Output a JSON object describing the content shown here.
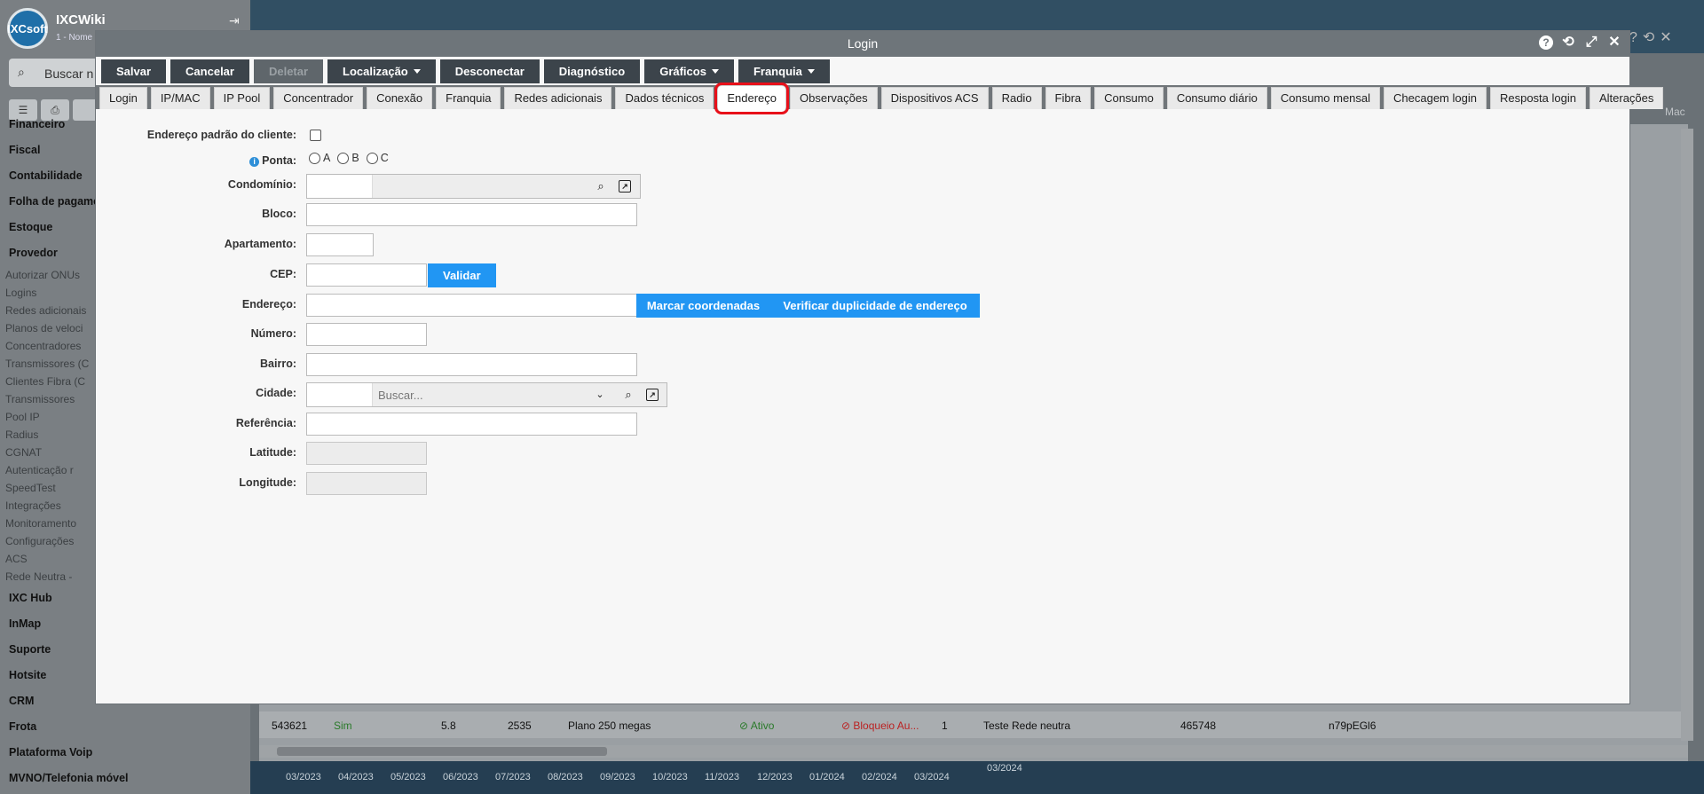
{
  "background": {
    "app_name": "IXCWiki",
    "app_sub": "1 - Nome",
    "logo_text": "IXCsoft",
    "search_placeholder": "Buscar n",
    "menu_top": [
      "Financeiro",
      "Fiscal",
      "Contabilidade",
      "Folha de pagame",
      "Estoque",
      "Provedor"
    ],
    "menu_sub": [
      "Autorizar ONUs",
      "Logins",
      "Redes adicionais",
      "Planos de veloci",
      "Concentradores",
      "Transmissores (C",
      "Clientes Fibra (C",
      "Transmissores",
      "Pool IP",
      "Radius",
      "CGNAT",
      "Autenticação r",
      "SpeedTest",
      "Integrações",
      "Monitoramento",
      "Configurações",
      "ACS",
      "Rede Neutra - "
    ],
    "menu_bottom": [
      "IXC Hub",
      "InMap",
      "Suporte",
      "Hotsite",
      "CRM",
      "Frota",
      "Plataforma Voip",
      "MVNO/Telefonia móvel"
    ],
    "row": {
      "id": "543621",
      "flag": "Sim",
      "v1": "5.8",
      "v2": "2535",
      "plan": "Plano 250 megas",
      "status": "Ativo",
      "block": "Bloqueio Au...",
      "n": "1",
      "desc": "Teste Rede neutra",
      "code": "465748",
      "hash": "n79pEGl6"
    },
    "mac_label": "Mac",
    "dates": [
      "03/2023",
      "04/2023",
      "05/2023",
      "06/2023",
      "07/2023",
      "08/2023",
      "09/2023",
      "10/2023",
      "11/2023",
      "12/2023",
      "01/2024",
      "02/2024",
      "03/2024",
      "03/2024"
    ]
  },
  "modal": {
    "title": "Login",
    "toolbar": {
      "save": "Salvar",
      "cancel": "Cancelar",
      "delete": "Deletar",
      "location": "Localização",
      "disconnect": "Desconectar",
      "diagnostic": "Diagnóstico",
      "charts": "Gráficos",
      "franchise": "Franquia"
    },
    "tabs": [
      "Login",
      "IP/MAC",
      "IP Pool",
      "Concentrador",
      "Conexão",
      "Franquia",
      "Redes adicionais",
      "Dados técnicos",
      "Endereço",
      "Observações",
      "Dispositivos ACS",
      "Radio",
      "Fibra",
      "Consumo",
      "Consumo diário",
      "Consumo mensal",
      "Checagem login",
      "Resposta login",
      "Alterações"
    ],
    "active_tab": "Endereço",
    "form": {
      "default_address_label": "Endereço padrão do cliente:",
      "ponta_label": "Ponta:",
      "ponta_options": [
        "A",
        "B",
        "C"
      ],
      "condominio_label": "Condomínio:",
      "bloco_label": "Bloco:",
      "apartamento_label": "Apartamento:",
      "cep_label": "CEP:",
      "validate_button": "Validar",
      "endereco_label": "Endereço:",
      "mark_coords_button": "Marcar coordenadas",
      "check_dup_button": "Verificar duplicidade de endereço",
      "numero_label": "Número:",
      "bairro_label": "Bairro:",
      "cidade_label": "Cidade:",
      "cidade_placeholder": "Buscar...",
      "referencia_label": "Referência:",
      "latitude_label": "Latitude:",
      "longitude_label": "Longitude:"
    }
  }
}
